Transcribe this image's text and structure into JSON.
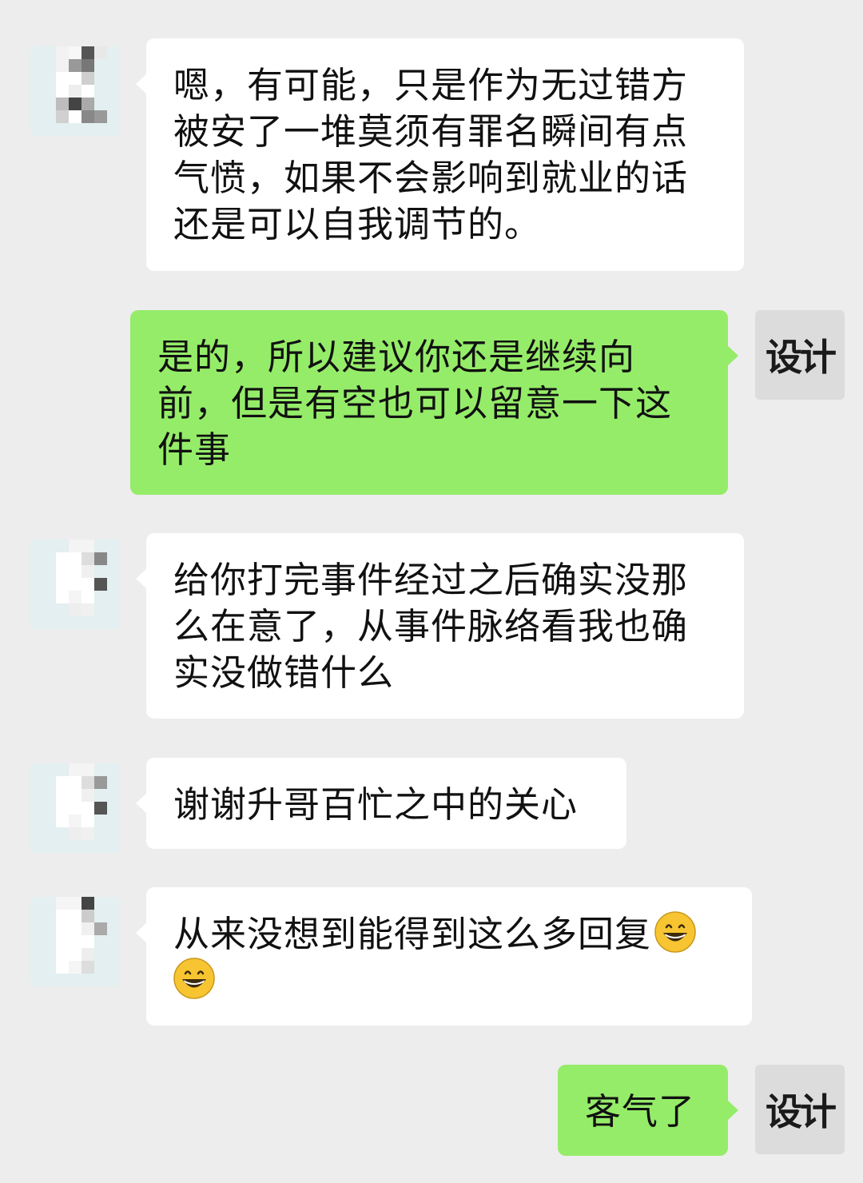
{
  "colors": {
    "background": "#ededed",
    "incoming_bubble": "#ffffff",
    "outgoing_bubble": "#95ec69",
    "self_avatar_bg": "#dcdcdc"
  },
  "self_avatar_text": "设计",
  "messages": [
    {
      "side": "left",
      "text": "嗯，有可能，只是作为无过错方被安了一堆莫须有罪名瞬间有点气愤，如果不会影响到就业的话还是可以自我调节的。"
    },
    {
      "side": "right",
      "text": "是的，所以建议你还是继续向前，但是有空也可以留意一下这件事"
    },
    {
      "side": "left",
      "text": "给你打完事件经过之后确实没那么在意了，从事件脉络看我也确实没做错什么"
    },
    {
      "side": "left",
      "text": "谢谢升哥百忙之中的关心"
    },
    {
      "side": "left",
      "text": "从来没想到能得到这么多回复",
      "emojis": [
        "grinning-face-emoji",
        "grinning-face-emoji"
      ]
    },
    {
      "side": "right",
      "text": "客气了"
    }
  ]
}
